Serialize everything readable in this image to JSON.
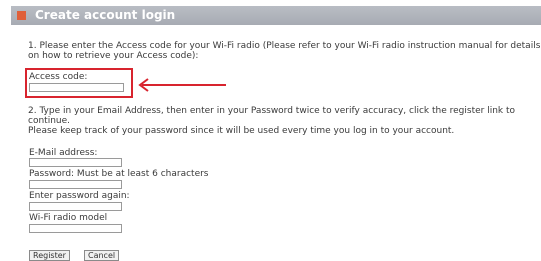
{
  "header": {
    "title": "Create account login"
  },
  "step1": {
    "line1": "1. Please enter the Access code for your Wi-Fi radio (Please refer to your Wi-Fi radio instruction manual for details",
    "line2": "on how to retrieve your Access code):"
  },
  "access_code": {
    "label": "Access code:",
    "value": ""
  },
  "step2": {
    "line1": "2. Type in your Email Address, then enter in your Password twice to verify accuracy, click the register link to",
    "line2": "continue.",
    "line3": "Please keep track of your password since it will be used every time you log in to your account."
  },
  "email": {
    "label": "E-Mail address:",
    "value": ""
  },
  "password": {
    "label": "Password: Must be at least 6 characters",
    "value": ""
  },
  "password_again": {
    "label": "Enter password again:",
    "value": ""
  },
  "radio_model": {
    "label": "Wi-Fi radio model",
    "value": ""
  },
  "buttons": {
    "register": "Register",
    "cancel": "Cancel"
  },
  "colors": {
    "header_bg": "#b0b4bb",
    "header_icon": "#e0603a",
    "highlight": "#d8242e"
  }
}
